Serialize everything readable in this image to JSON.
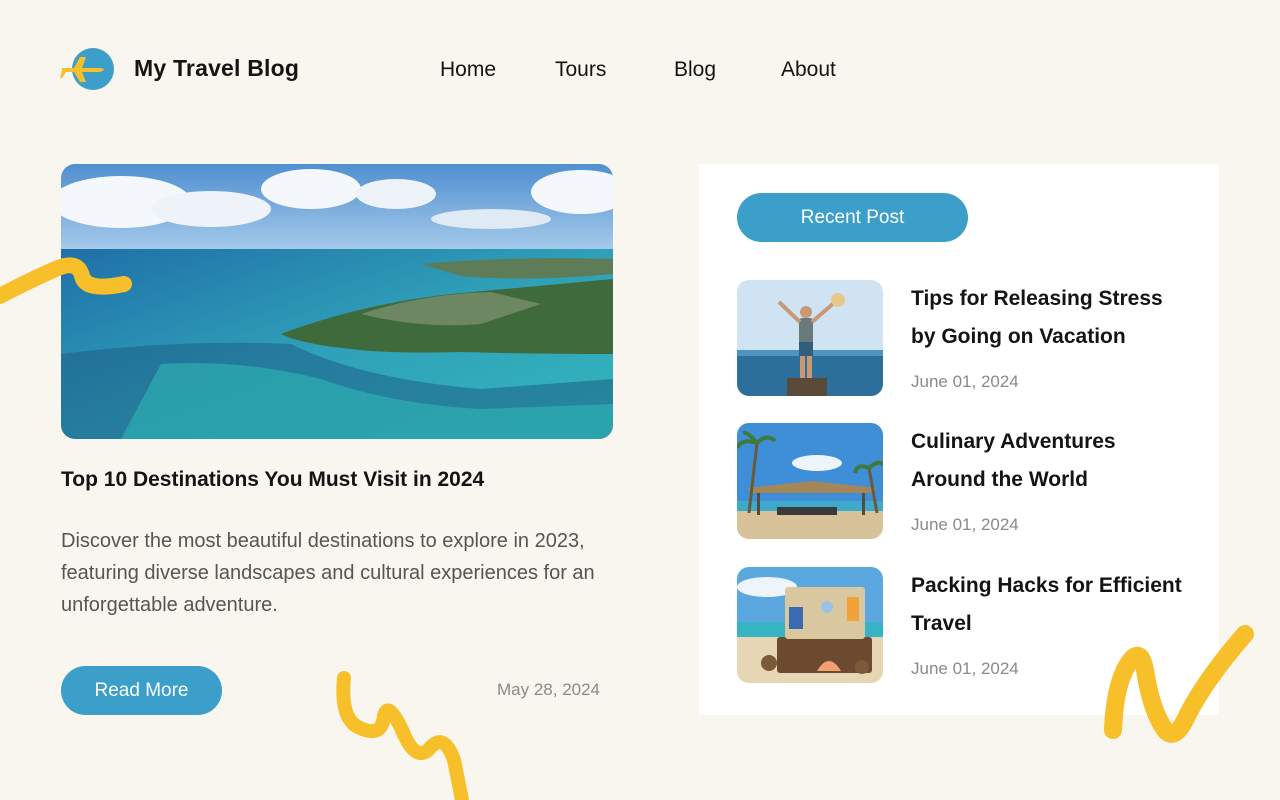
{
  "header": {
    "brand": "My Travel Blog",
    "nav": [
      "Home",
      "Tours",
      "Blog",
      "About"
    ]
  },
  "featured": {
    "title": "Top 10 Destinations You Must Visit in 2024",
    "description": "Discover the most beautiful destinations to explore in 2023, featuring diverse landscapes and cultural experiences for an unforgettable adventure.",
    "button_label": "Read More",
    "date": "May 28, 2024"
  },
  "recent": {
    "badge": "Recent Post",
    "posts": [
      {
        "title": "Tips for Releasing Stress by Going on Vacation",
        "date": "June 01, 2024"
      },
      {
        "title": "Culinary Adventures Around the World",
        "date": "June 01, 2024"
      },
      {
        "title": "Packing Hacks for Efficient Travel",
        "date": "June 01, 2024"
      }
    ]
  },
  "colors": {
    "background": "#f9f5ef",
    "accent": "#3b9fc9",
    "squiggle": "#f7bf2a"
  },
  "icons": [
    "airplane-icon"
  ]
}
